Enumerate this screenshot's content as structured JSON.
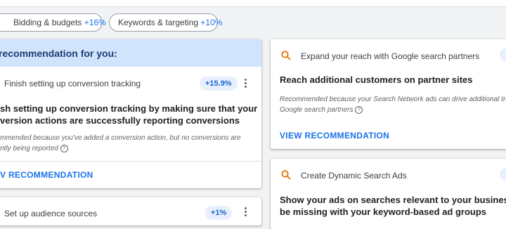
{
  "chips": [
    {
      "label": "Bidding & budgets",
      "pct": "+16%"
    },
    {
      "label": "Keywords & targeting",
      "pct": "+10%"
    }
  ],
  "left": {
    "header": "recommendation for you:",
    "item1": {
      "title": "Finish setting up conversion tracking",
      "badge": "+15.9%",
      "heading_l1": "sh setting up conversion tracking by making sure that your",
      "heading_l2": "version actions are successfully reporting conversions",
      "note_l1": "mmended because you've added a conversion action, but no conversions are",
      "note_l2": "ntly being reported",
      "action": "V RECOMMENDATION"
    },
    "item2": {
      "title": "Set up audience sources",
      "badge": "+1%"
    }
  },
  "right": {
    "card1": {
      "title": "Expand your reach with Google search partners",
      "heading": "Reach additional customers on partner sites",
      "note_l1": "Recommended because your Search Network ads can drive additional tra",
      "note_l2": "Google search partners",
      "action": "VIEW RECOMMENDATION"
    },
    "card2": {
      "title": "Create Dynamic Search Ads",
      "heading_l1": "Show your ads on searches relevant to your business that",
      "heading_l2": "be missing with your keyword-based ad groups"
    }
  },
  "colors": {
    "accent": "#1a73e8",
    "header_bg": "#d2e3fc",
    "search_icon": "#e37400"
  }
}
